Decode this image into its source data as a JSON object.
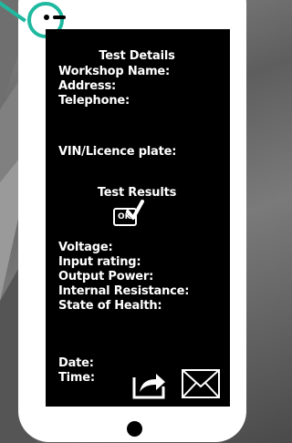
{
  "colors": {
    "accent": "#1fb9a0",
    "screen": "#000000",
    "body": "#ffffff"
  },
  "screen": {
    "heading_details": "Test Details",
    "workshop_label": "Workshop Name:",
    "address_label": "Address:",
    "telephone_label": "Telephone:",
    "vin_label": "VIN/Licence plate:",
    "heading_results": "Test Results",
    "ok_badge": "OK",
    "voltage_label": "Voltage:",
    "input_rating_label": "Input rating:",
    "output_power_label": "Output Power:",
    "internal_resistance_label": "Internal Resistance:",
    "state_of_health_label": "State of Health:",
    "date_label": "Date:",
    "time_label": "Time:"
  },
  "icons": {
    "share": "share-icon",
    "mail": "mail-icon",
    "ok_check": "ok-check-icon"
  }
}
